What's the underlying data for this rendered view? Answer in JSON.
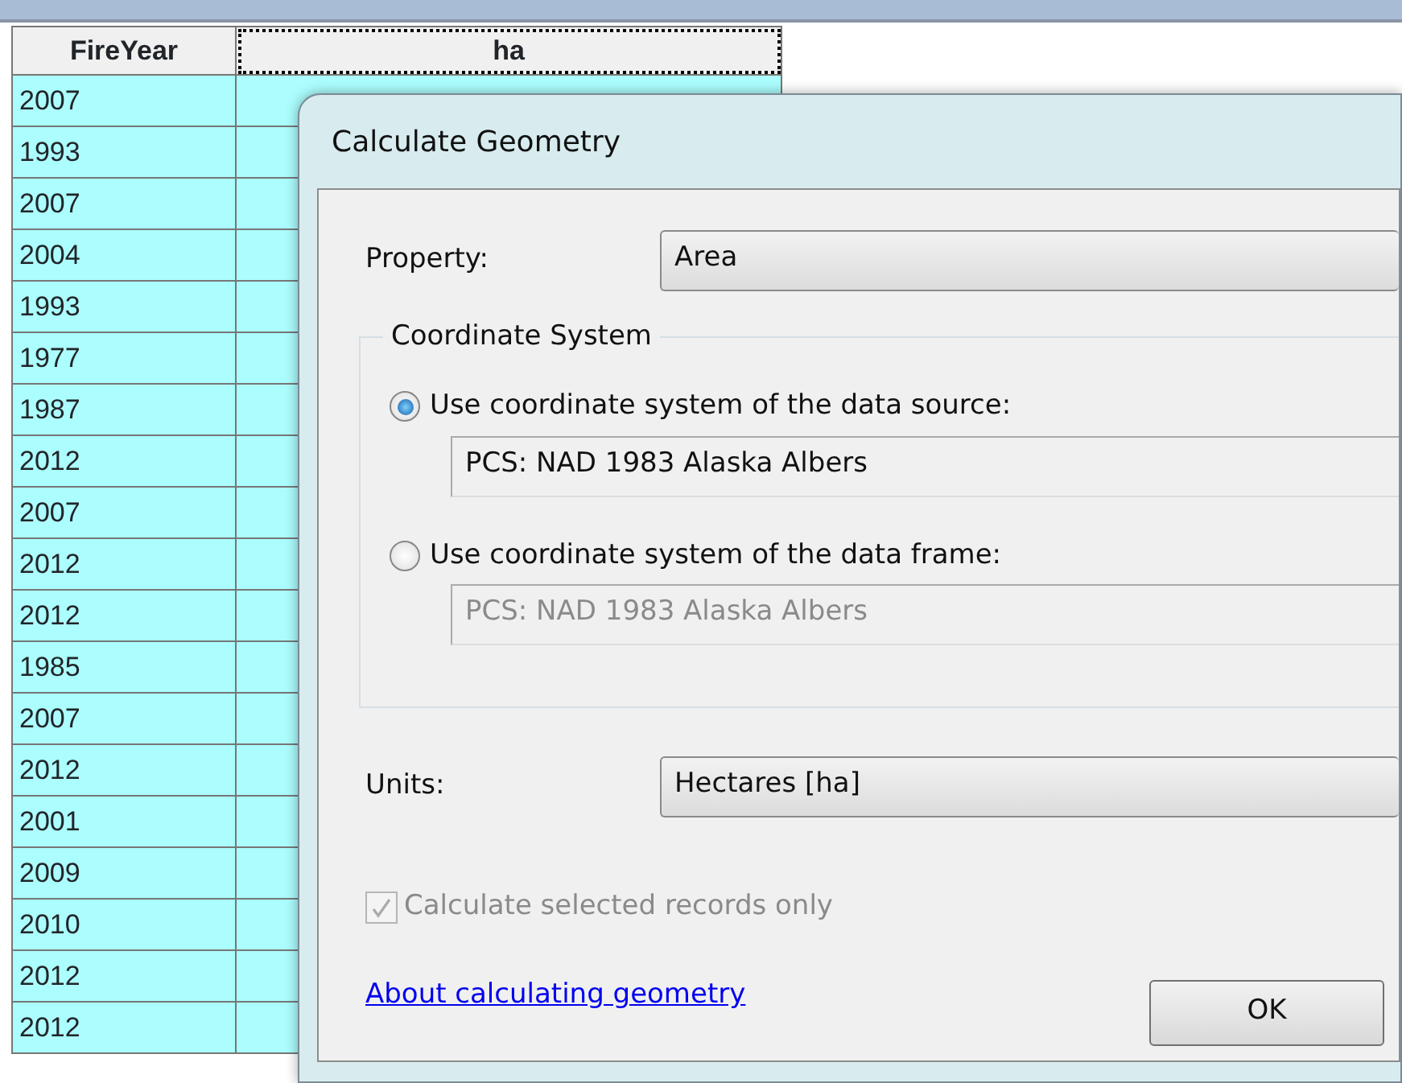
{
  "table": {
    "columns": [
      {
        "label": "FireYear",
        "selected": false
      },
      {
        "label": "ha",
        "selected": true
      }
    ],
    "rows": [
      "2007",
      "1993",
      "2007",
      "2004",
      "1993",
      "1977",
      "1987",
      "2012",
      "2007",
      "2012",
      "2012",
      "1985",
      "2007",
      "2012",
      "2001",
      "2009",
      "2010",
      "2012",
      "2012"
    ]
  },
  "dialog": {
    "title": "Calculate Geometry",
    "property": {
      "label": "Property:",
      "value": "Area"
    },
    "coordinate_system": {
      "title": "Coordinate System",
      "options": [
        {
          "label": "Use coordinate system of the data source:",
          "selected": true,
          "value": "PCS: NAD 1983 Alaska Albers"
        },
        {
          "label": "Use coordinate system of the data frame:",
          "selected": false,
          "value": "PCS: NAD 1983 Alaska Albers"
        }
      ]
    },
    "units": {
      "label": "Units:",
      "value": "Hectares [ha]"
    },
    "checkbox": {
      "label": "Calculate selected records only",
      "checked": true,
      "disabled": true
    },
    "link": "About calculating geometry",
    "buttons": [
      "OK"
    ]
  }
}
